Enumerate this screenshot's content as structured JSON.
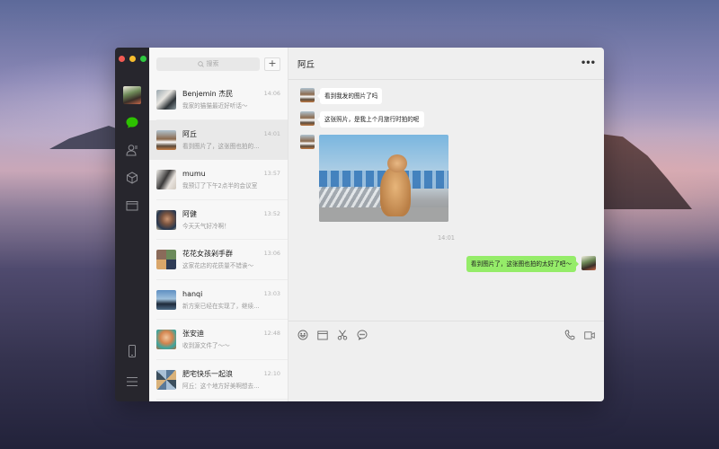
{
  "window": {
    "traffic_lights": [
      "close",
      "minimize",
      "maximize"
    ]
  },
  "sidebar": {
    "items": [
      {
        "name": "profile-avatar"
      },
      {
        "name": "chats",
        "icon": "chat-bubble-icon",
        "active": true,
        "color": "#2dc100"
      },
      {
        "name": "contacts",
        "icon": "contacts-icon"
      },
      {
        "name": "mini-programs",
        "icon": "cube-icon"
      },
      {
        "name": "files",
        "icon": "folder-icon"
      }
    ],
    "bottom": [
      {
        "name": "phone",
        "icon": "mobile-phone-icon"
      },
      {
        "name": "menu",
        "icon": "hamburger-menu-icon"
      }
    ]
  },
  "search": {
    "placeholder": "搜索",
    "add_label": "+"
  },
  "chats": [
    {
      "name": "Benjemin 杰民",
      "preview": "我家的猫猫最近好听话～",
      "time": "14:06",
      "active": false
    },
    {
      "name": "阿丘",
      "preview": "看到图片了，这张图也拍的...",
      "time": "14:01",
      "active": true
    },
    {
      "name": "mumu",
      "preview": "我预订了下午2点半的会议室",
      "time": "13:57",
      "active": false
    },
    {
      "name": "阿健",
      "preview": "今天天气好冷啊！",
      "time": "13:52",
      "active": false
    },
    {
      "name": "花花女孩剁手群",
      "preview": "这家花店的花质量不错诶～",
      "time": "13:06",
      "active": false
    },
    {
      "name": "hanqi",
      "preview": "新方案已经在实现了，继续...",
      "time": "13:03",
      "active": false
    },
    {
      "name": "张安迪",
      "preview": "收到源文件了～～",
      "time": "12:48",
      "active": false
    },
    {
      "name": "肥宅快乐一起浪",
      "preview": "阿丘：这个地方好美啊想去...",
      "time": "12:10",
      "active": false
    }
  ],
  "conversation": {
    "title": "阿丘",
    "more_label": "•••",
    "messages": [
      {
        "direction": "in",
        "type": "text",
        "text": "看到我发的图片了吗"
      },
      {
        "direction": "in",
        "type": "text",
        "text": "这张照片，是我上个月旅行时拍的呢"
      },
      {
        "direction": "in",
        "type": "image",
        "alt": "cat photo"
      },
      {
        "type": "timestamp",
        "text": "14:01"
      },
      {
        "direction": "out",
        "type": "text",
        "text": "看到图片了，这张图也拍的太好了吧～"
      }
    ],
    "toolbar": {
      "left": [
        "emoji-icon",
        "folder-icon",
        "scissors-icon",
        "chat-history-icon"
      ],
      "right": [
        "phone-call-icon",
        "video-call-icon"
      ]
    },
    "outgoing_bubble_color": "#95ec69"
  }
}
